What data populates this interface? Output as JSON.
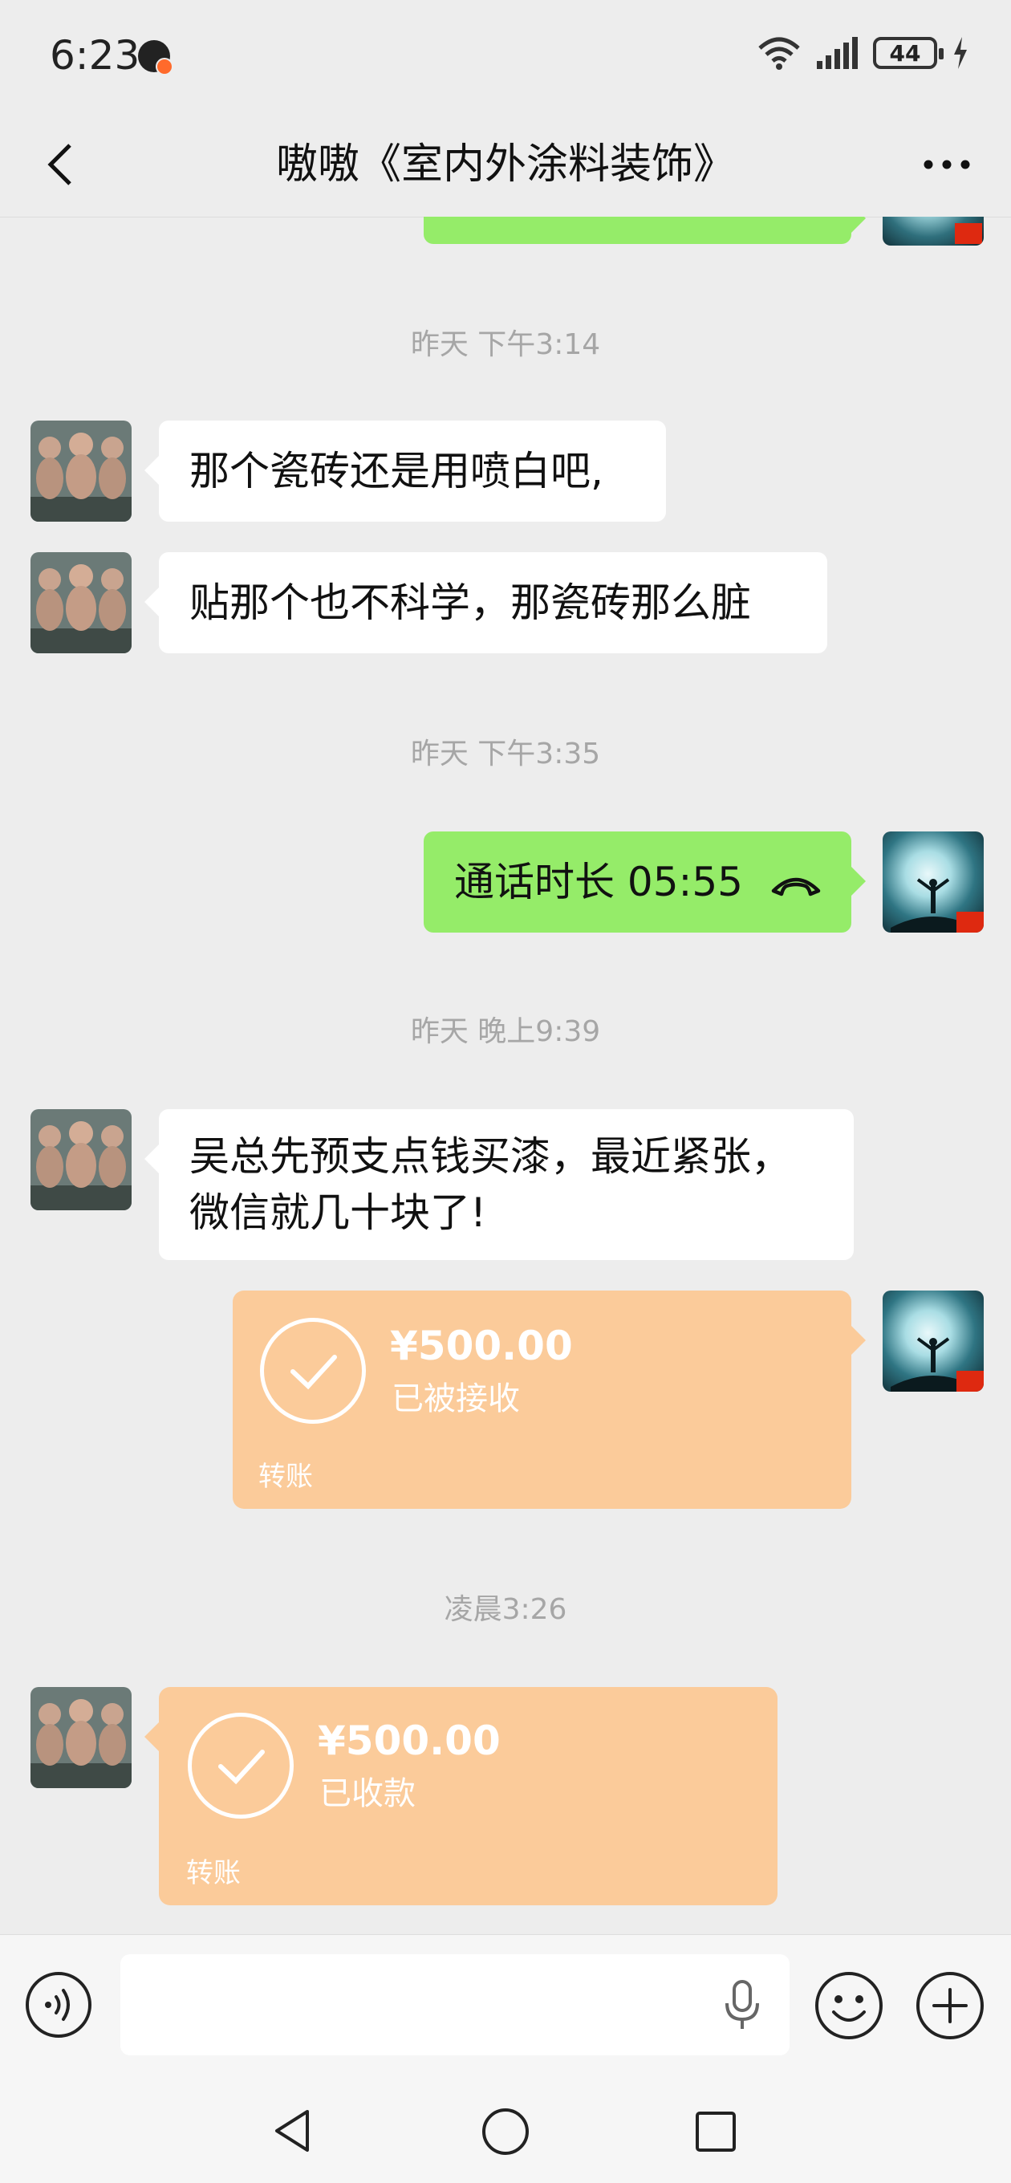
{
  "status_bar": {
    "time": "6:23",
    "battery": "44"
  },
  "header": {
    "title": "嗷嗷《室内外涂料装饰》"
  },
  "messages": {
    "ts1": "昨天 下午3:14",
    "m1": "那个瓷砖还是用喷白吧,",
    "m2": "贴那个也不科学，那瓷砖那么脏",
    "ts2": "昨天 下午3:35",
    "call": "通话时长 05:55",
    "ts3": "昨天 晚上9:39",
    "m3_line1": "吴总先预支点钱买漆，最近紧张，",
    "m3_line2": "微信就几十块了!",
    "transfer1": {
      "amount": "¥500.00",
      "status": "已被接收",
      "label": "转账"
    },
    "ts4": "凌晨3:26",
    "transfer2": {
      "amount": "¥500.00",
      "status": "已收款",
      "label": "转账"
    }
  },
  "input": {
    "value": "",
    "placeholder": ""
  },
  "colors": {
    "background": "#ededed",
    "sent_bubble": "#95ec69",
    "received_bubble": "#ffffff",
    "transfer_card": "#fbcb9a",
    "timestamp_text": "#a6a6a6"
  },
  "icons": [
    "back-arrow-icon",
    "more-dots-icon",
    "wifi-icon",
    "signal-icon",
    "battery-icon",
    "charging-icon",
    "phone-hangup-icon",
    "checkmark-icon",
    "voice-input-icon",
    "microphone-icon",
    "emoji-icon",
    "plus-icon",
    "nav-back-icon",
    "nav-home-icon",
    "nav-recents-icon"
  ]
}
